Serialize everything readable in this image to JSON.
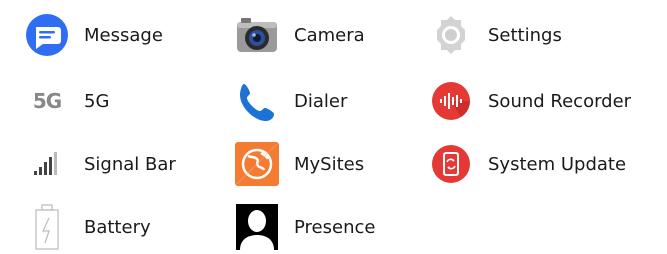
{
  "items": [
    {
      "label": "Message",
      "icon": "message-icon",
      "color": "#2f6df3"
    },
    {
      "label": "Camera",
      "icon": "camera-icon",
      "color": "#6b6b6b"
    },
    {
      "label": "Settings",
      "icon": "gear-icon",
      "color": "#d0d0d0"
    },
    {
      "label": "5G",
      "icon": "5g-icon",
      "icon_text": "5G",
      "color": "#888888"
    },
    {
      "label": "Dialer",
      "icon": "phone-icon",
      "color": "#1d72d6"
    },
    {
      "label": "Sound Recorder",
      "icon": "sound-recorder-icon",
      "color": "#e53935"
    },
    {
      "label": "Signal Bar",
      "icon": "signal-bar-icon",
      "color": "#444444"
    },
    {
      "label": "MySites",
      "icon": "mysites-icon",
      "color": "#f47b32"
    },
    {
      "label": "System Update",
      "icon": "system-update-icon",
      "color": "#e53935"
    },
    {
      "label": "Battery",
      "icon": "battery-icon",
      "color": "#bbbbbb"
    },
    {
      "label": "Presence",
      "icon": "presence-icon",
      "color": "#000000"
    }
  ]
}
